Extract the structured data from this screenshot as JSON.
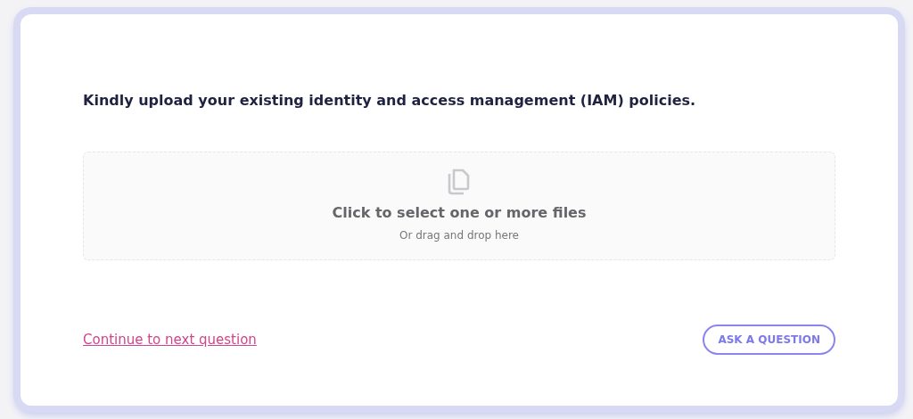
{
  "question": "Kindly upload your existing identity and access management (IAM) policies.",
  "dropzone": {
    "title": "Click to select one or more files",
    "hint": "Or drag and drop here"
  },
  "continue_link": "Continue to next question",
  "ask_button": "ASK A QUESTION"
}
